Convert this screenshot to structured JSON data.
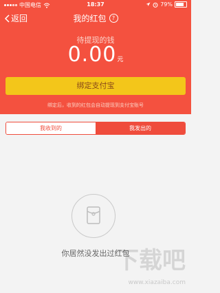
{
  "status_bar": {
    "carrier": "中国电信",
    "wifi_icon": "wifi-icon",
    "time": "18:37",
    "battery": "79%",
    "battery_level": 0.79
  },
  "nav": {
    "back_label": "返回",
    "title": "我的红包",
    "help_glyph": "?"
  },
  "balance": {
    "caption": "待提现的钱",
    "amount": "0.00",
    "unit": "元"
  },
  "bind_button_label": "绑定支付宝",
  "hint_text": "绑定后，收到的红包会自动提现到支付宝账号",
  "tabs": [
    {
      "label": "我收到的",
      "selected": false
    },
    {
      "label": "我发出的",
      "selected": true
    }
  ],
  "empty_state": {
    "text": "你居然没发出过红包"
  },
  "watermark": {
    "brand": "下载吧",
    "url": "www.xiazaiba.com"
  },
  "colors": {
    "header_red": "#f4513f",
    "button_yellow": "#f3c61a",
    "tab_red": "#ef4c3c",
    "background": "#f3f3f3"
  }
}
